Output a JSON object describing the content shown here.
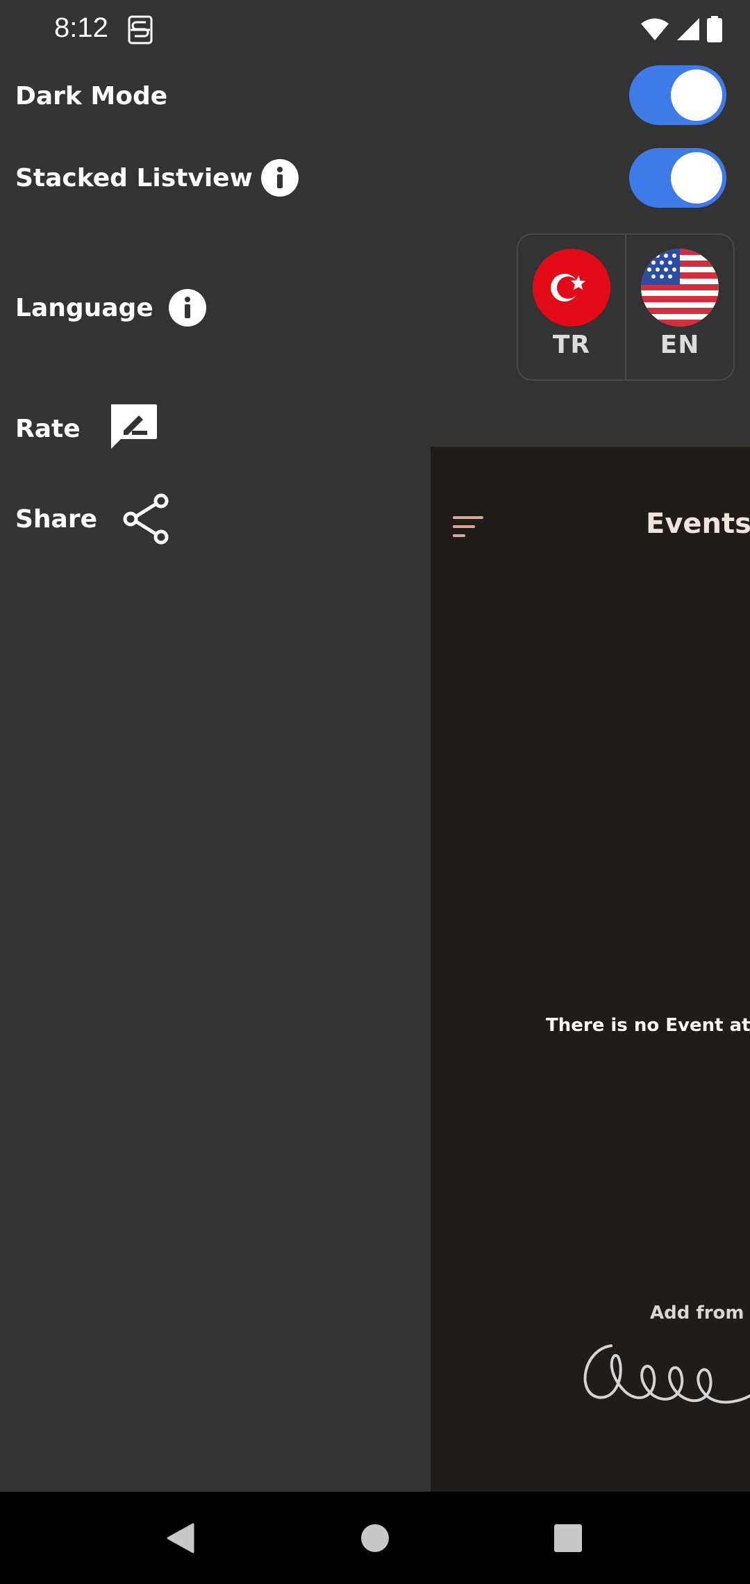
{
  "status_bar": {
    "time": "8:12",
    "app_icon": "s-badge-icon",
    "icons": [
      "wifi-icon",
      "signal-icon",
      "battery-icon"
    ]
  },
  "drawer": {
    "dark_mode": {
      "label": "Dark Mode",
      "toggle_on": true
    },
    "stacked_listview": {
      "label": "Stacked Listview",
      "toggle_on": true,
      "icon": "info-icon"
    },
    "language": {
      "label": "Language",
      "icon": "info-icon",
      "options": [
        {
          "code": "TR",
          "flag": "turkey-flag-icon"
        },
        {
          "code": "EN",
          "flag": "usa-flag-icon"
        }
      ]
    },
    "rate": {
      "label": "Rate",
      "icon": "rate-review-icon"
    },
    "share": {
      "label": "Share",
      "icon": "share-icon"
    }
  },
  "main": {
    "title": "Events",
    "empty_message": "There is no Event at th",
    "add_hint": "Add from h",
    "menu_icon": "sort-menu-icon"
  },
  "nav_bar": {
    "buttons": [
      "back-icon",
      "home-icon",
      "recents-icon"
    ]
  },
  "colors": {
    "drawer_bg": "#333333",
    "main_bg": "#201c1a",
    "toggle_accent": "#3f7be8",
    "events_title": "#f1e4df"
  }
}
